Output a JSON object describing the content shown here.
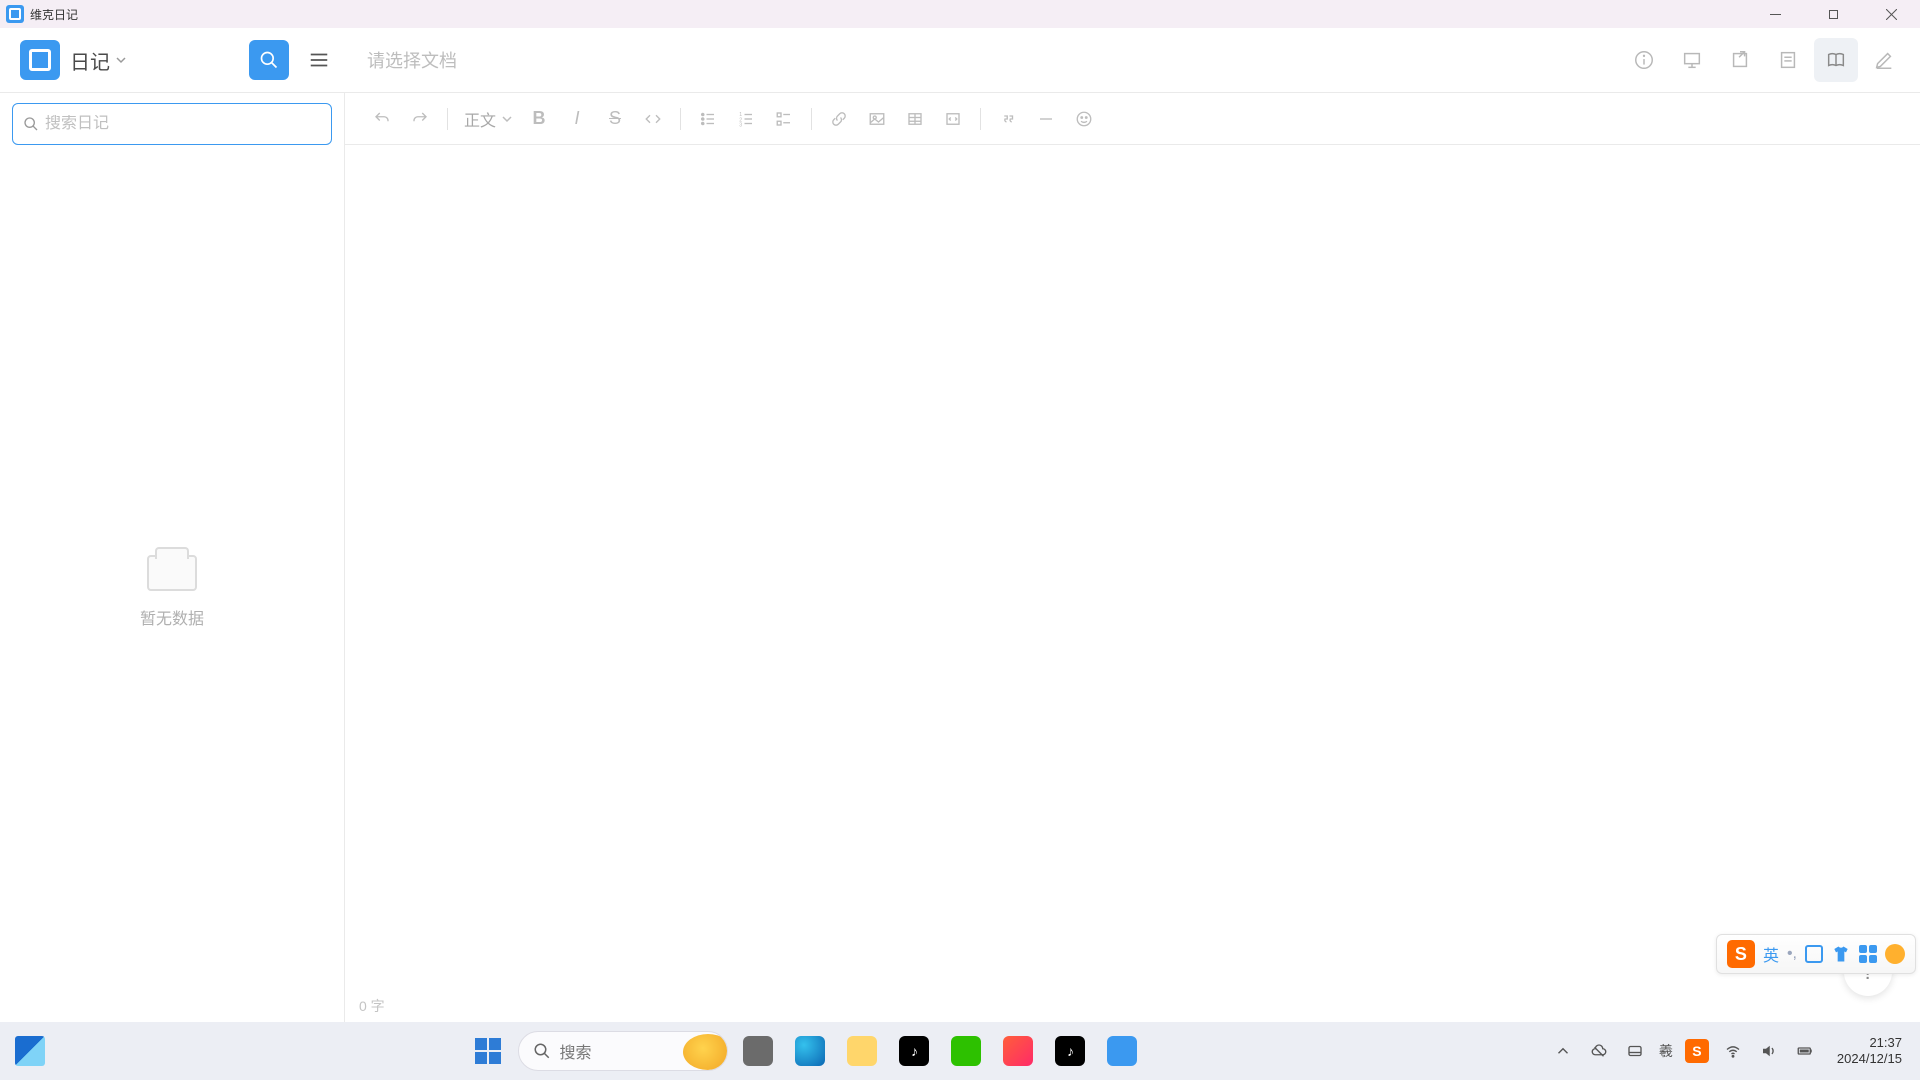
{
  "titlebar": {
    "app_name": "维克日记"
  },
  "header": {
    "diary_label": "日记",
    "doc_placeholder": "请选择文档"
  },
  "sidebar": {
    "search_placeholder": "搜索日记",
    "empty_text": "暂无数据"
  },
  "toolbar": {
    "style_label": "正文"
  },
  "status": {
    "word_count_label": "0 字"
  },
  "help_fab": "?",
  "ime": {
    "lang": "英",
    "punct": "•,"
  },
  "taskbar": {
    "search_placeholder": "搜索",
    "time": "21:37",
    "date": "2024/12/15",
    "tray_char": "羲"
  }
}
